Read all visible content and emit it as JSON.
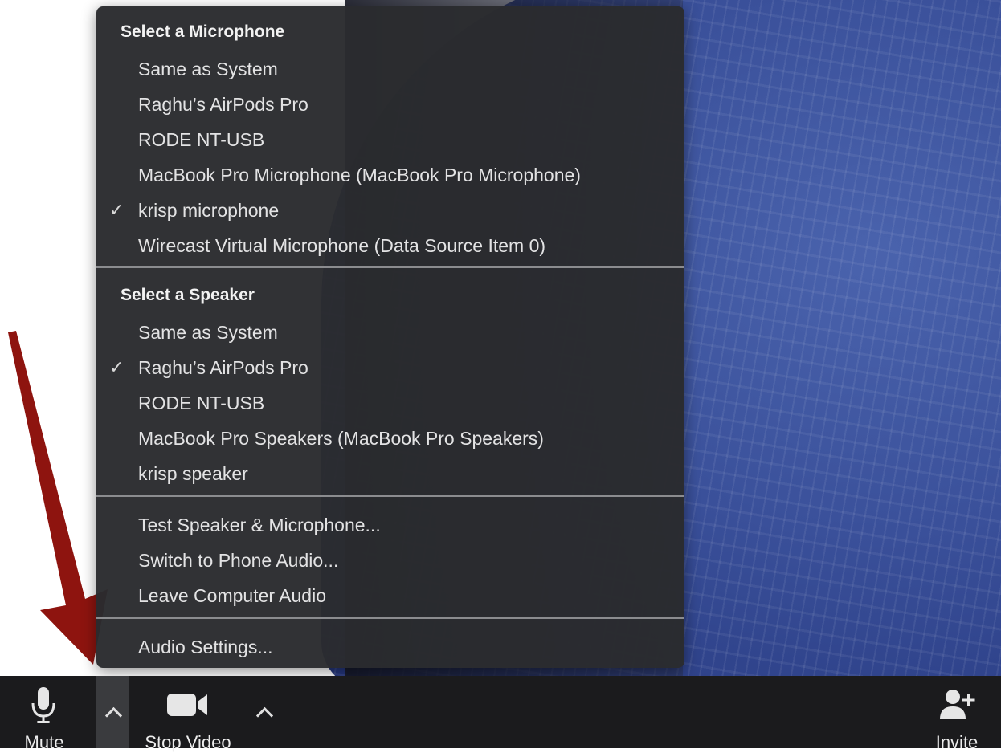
{
  "microphone_section": {
    "title": "Select a Microphone",
    "items": [
      {
        "label": "Same as System",
        "checked": false
      },
      {
        "label": "Raghu’s AirPods Pro",
        "checked": false
      },
      {
        "label": "RODE NT-USB",
        "checked": false
      },
      {
        "label": "MacBook Pro Microphone (MacBook Pro Microphone)",
        "checked": false
      },
      {
        "label": "krisp microphone",
        "checked": true
      },
      {
        "label": "Wirecast Virtual Microphone (Data Source Item 0)",
        "checked": false
      }
    ]
  },
  "speaker_section": {
    "title": "Select a Speaker",
    "items": [
      {
        "label": "Same as System",
        "checked": false
      },
      {
        "label": "Raghu’s AirPods Pro",
        "checked": true
      },
      {
        "label": "RODE NT-USB",
        "checked": false
      },
      {
        "label": "MacBook Pro Speakers (MacBook Pro Speakers)",
        "checked": false
      },
      {
        "label": "krisp speaker",
        "checked": false
      }
    ]
  },
  "actions": {
    "items": [
      {
        "label": "Test Speaker & Microphone..."
      },
      {
        "label": "Switch to Phone Audio..."
      },
      {
        "label": "Leave Computer Audio"
      }
    ]
  },
  "settings": {
    "label": "Audio Settings..."
  },
  "check_mark": "✓",
  "toolbar": {
    "mute_label": "Mute",
    "stop_video_label": "Stop Video",
    "invite_label": "Invite"
  },
  "icons": {
    "mute": "microphone-icon",
    "video": "video-camera-icon",
    "invite": "add-person-icon",
    "caret": "chevron-up-icon"
  },
  "colors": {
    "menu_bg": "#2a2b2e",
    "toolbar_bg": "#1b1b1d",
    "arrow": "#8e140f"
  }
}
